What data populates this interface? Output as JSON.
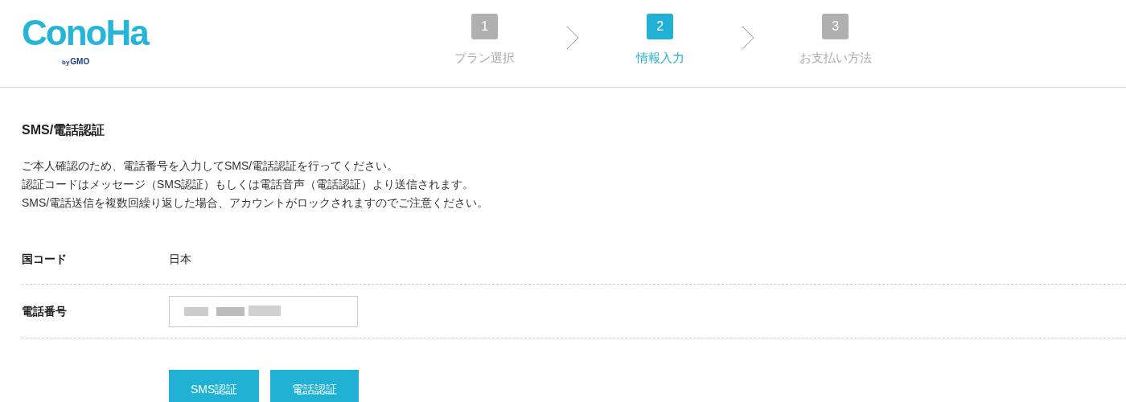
{
  "logo": {
    "name": "ConoHa",
    "by": "by",
    "company": "GMO"
  },
  "steps": [
    {
      "number": "1",
      "label": "プラン選択",
      "selected": false
    },
    {
      "number": "2",
      "label": "情報入力",
      "selected": true
    },
    {
      "number": "3",
      "label": "お支払い方法",
      "selected": false
    }
  ],
  "section": {
    "title": "SMS/電話認証",
    "description": [
      "ご本人確認のため、電話番号を入力してSMS/電話認証を行ってください。",
      "認証コードはメッセージ（SMS認証）もしくは電話音声（電話認証）より送信されます。",
      "SMS/電話送信を複数回繰り返した場合、アカウントがロックされますのでご注意ください。"
    ]
  },
  "fields": [
    {
      "kind": "text",
      "label": "国コード",
      "value": "日本"
    },
    {
      "kind": "redacted_input",
      "label": "電話番号"
    }
  ],
  "buttons": [
    "SMS認証",
    "電話認証"
  ]
}
